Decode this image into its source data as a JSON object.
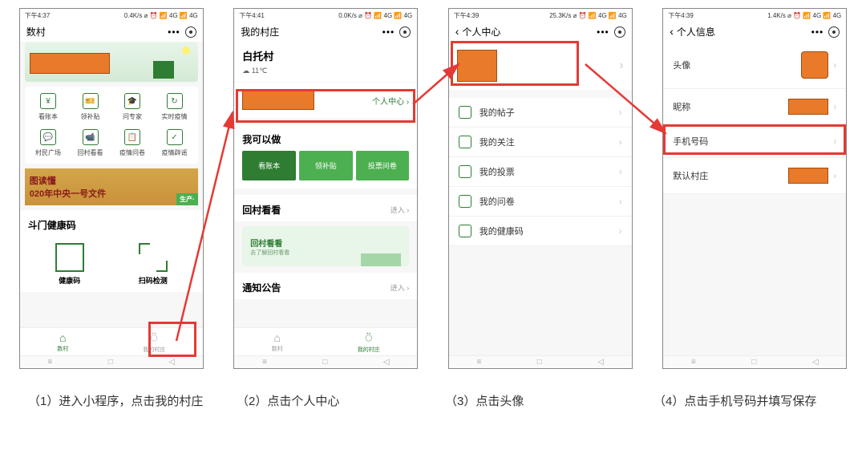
{
  "screen1": {
    "status_time": "下午4:37",
    "status_net": "0.4K/s ⌀ ⏰ 📶 4G 📶 4G",
    "title": "数村",
    "grid": [
      {
        "label": "看账本",
        "icon": "¥"
      },
      {
        "label": "领补贴",
        "icon": "🎫"
      },
      {
        "label": "问专家",
        "icon": "🎓"
      },
      {
        "label": "实时疫情",
        "icon": "↻"
      },
      {
        "label": "村民广场",
        "icon": "💬"
      },
      {
        "label": "回村看看",
        "icon": "📹"
      },
      {
        "label": "疫情问卷",
        "icon": "📋"
      },
      {
        "label": "疫情辟谣",
        "icon": "✓"
      }
    ],
    "ad_line1": "图读懂",
    "ad_line2": "020年中央一号文件",
    "ad_tag": "生产·",
    "section": "斗门健康码",
    "qr1": "健康码",
    "qr2": "扫码检测",
    "nav1": "数村",
    "nav2": "我的村庄"
  },
  "screen2": {
    "status_time": "下午4:41",
    "status_net": "0.0K/s ⌀ ⏰ 📶 4G 📶 4G",
    "title": "我的村庄",
    "village": "白托村",
    "temp": "☁ 11℃",
    "pc_link": "个人中心",
    "sec1": "我可以做",
    "btns": [
      "看账本",
      "领补贴",
      "投票问卷"
    ],
    "sec2": "回村看看",
    "more": "进入 ›",
    "ret_t": "回村看看",
    "ret_s": "去了解回村看看",
    "sec3": "通知公告",
    "nav1": "数村",
    "nav2": "我的村庄"
  },
  "screen3": {
    "status_time": "下午4:39",
    "status_net": "25.3K/s ⌀ ⏰ 📶 4G 📶 4G",
    "title": "个人中心",
    "items": [
      "我的帖子",
      "我的关注",
      "我的投票",
      "我的问卷",
      "我的健康码"
    ]
  },
  "screen4": {
    "status_time": "下午4:39",
    "status_net": "1.4K/s ⌀ ⏰ 📶 4G 📶 4G",
    "title": "个人信息",
    "rows": [
      {
        "label": "头像"
      },
      {
        "label": "昵称"
      },
      {
        "label": "手机号码"
      },
      {
        "label": "默认村庄"
      }
    ]
  },
  "captions": [
    "（1）进入小程序，点击我的村庄",
    "（2）点击个人中心",
    "（3）点击头像",
    "（4）点击手机号码并填写保存"
  ]
}
